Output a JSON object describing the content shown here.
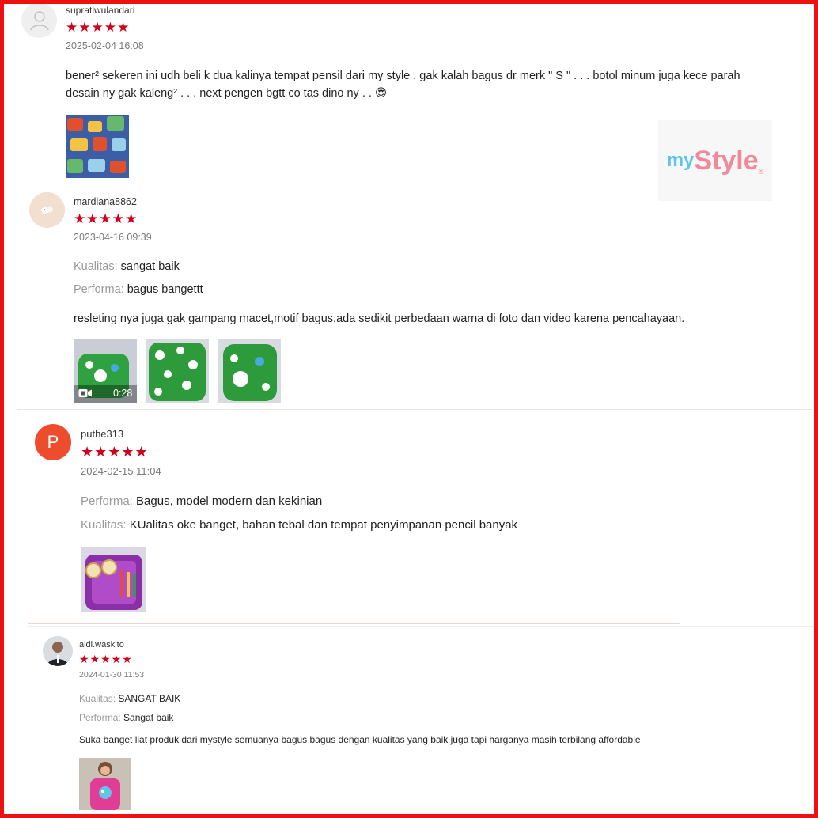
{
  "reviews": [
    {
      "username": "supratiwulandari",
      "stars": "★★★★★",
      "date": "2025-02-04 16:08",
      "text_line1": "bener² sekeren ini udh beli k dua kalinya tempat pensil dari my style .  gak kalah bagus dr merk \" S \" . . . botol minum juga kece parah",
      "text_line2": "desain ny gak kaleng² . . . next pengen bgtt co tas dino ny . . 😍"
    },
    {
      "username": "mardiana8862",
      "stars": "★★★★★",
      "date": "2023-04-16 09:39",
      "label1": "Kualitas:",
      "value1": "sangat baik",
      "label2": "Performa:",
      "value2": "bagus bangettt",
      "text": "resleting nya juga gak gampang macet,motif bagus.ada sedikit perbedaan warna di foto dan video karena pencahayaan.",
      "video_duration": "0:28"
    },
    {
      "avatar_letter": "P",
      "username": "puthe313",
      "stars": "★★★★★",
      "date": "2024-02-15 11:04",
      "label1": "Performa:",
      "value1": "Bagus, model modern dan kekinian",
      "label2": "Kualitas:",
      "value2": "KUalitas oke banget, bahan tebal dan tempat penyimpanan pencil banyak"
    },
    {
      "username": "aldi.waskito",
      "stars": "★★★★★",
      "date": "2024-01-30 11:53",
      "label1": "Kualitas:",
      "value1": "SANGAT BAIK",
      "label2": "Performa:",
      "value2": "Sangat baik",
      "text": "Suka banget liat produk dari mystyle semuanya bagus bagus dengan kualitas yang baik juga tapi harganya masih terbilang affordable"
    }
  ],
  "brand_logo": {
    "part1": "my",
    "part2": "Style",
    "mark": "®",
    "color1": "#5bc6e8",
    "color2": "#f08a9a"
  },
  "colors": {
    "star": "#d0011b",
    "frame": "#ee1111",
    "avatar_p": "#ee4d2d"
  }
}
